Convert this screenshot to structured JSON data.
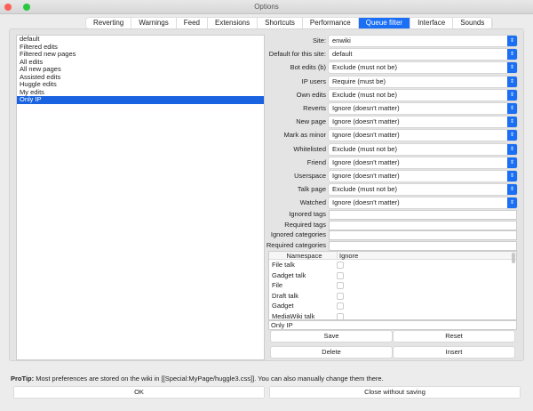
{
  "window": {
    "title": "Options"
  },
  "tabs": [
    "Reverting",
    "Warnings",
    "Feed",
    "Extensions",
    "Shortcuts",
    "Performance",
    "Queue filter",
    "Interface",
    "Sounds"
  ],
  "active_tab": "Queue filter",
  "queues": [
    "default",
    "Filtered edits",
    "Filtered new pages",
    "All edits",
    "All new pages",
    "Assisted edits",
    "Huggle edits",
    "My edits",
    "Only IP"
  ],
  "selected_queue": "Only IP",
  "filters": [
    {
      "label": "Site:",
      "value": "enwiki"
    },
    {
      "label": "Default for this site:",
      "value": "default"
    },
    {
      "label": "Bot edits (b)",
      "value": "Exclude (must not be)"
    },
    {
      "label": "IP users",
      "value": "Require (must be)"
    },
    {
      "label": "Own edits",
      "value": "Exclude (must not be)"
    },
    {
      "label": "Reverts",
      "value": "Ignore (doesn't matter)"
    },
    {
      "label": "New page",
      "value": "Ignore (doesn't matter)"
    },
    {
      "label": "Mark as minor",
      "value": "Ignore (doesn't matter)"
    },
    {
      "label": "Whitelisted",
      "value": "Exclude (must not be)"
    },
    {
      "label": "Friend",
      "value": "Ignore (doesn't matter)"
    },
    {
      "label": "Userspace",
      "value": "Ignore (doesn't matter)"
    },
    {
      "label": "Talk page",
      "value": "Exclude (must not be)"
    },
    {
      "label": "Watched",
      "value": "Ignore (doesn't matter)"
    }
  ],
  "text_fields": [
    {
      "label": "Ignored tags",
      "value": ""
    },
    {
      "label": "Required tags",
      "value": ""
    },
    {
      "label": "Ignored categories",
      "value": ""
    },
    {
      "label": "Required categories",
      "value": ""
    }
  ],
  "namespace_table": {
    "headers": [
      "Namespace",
      "Ignore"
    ],
    "rows": [
      {
        "name": "File talk",
        "ignore": false
      },
      {
        "name": "Gadget talk",
        "ignore": false
      },
      {
        "name": "File",
        "ignore": false
      },
      {
        "name": "Draft talk",
        "ignore": false
      },
      {
        "name": "Gadget",
        "ignore": false
      },
      {
        "name": "MediaWiki talk",
        "ignore": false
      }
    ]
  },
  "queue_name": "Only IP",
  "buttons": {
    "save": "Save",
    "reset": "Reset",
    "delete": "Delete",
    "insert": "Insert",
    "ok": "OK",
    "close": "Close without saving"
  },
  "protip": {
    "label": "ProTip:",
    "text": " Most preferences are stored on the wiki in [[Special:MyPage/huggle3.css]]. You can also manually change them there."
  },
  "colors": {
    "accent": "#1a6ff5",
    "close_light": "#fc5f57",
    "zoom_light": "#28c840"
  }
}
